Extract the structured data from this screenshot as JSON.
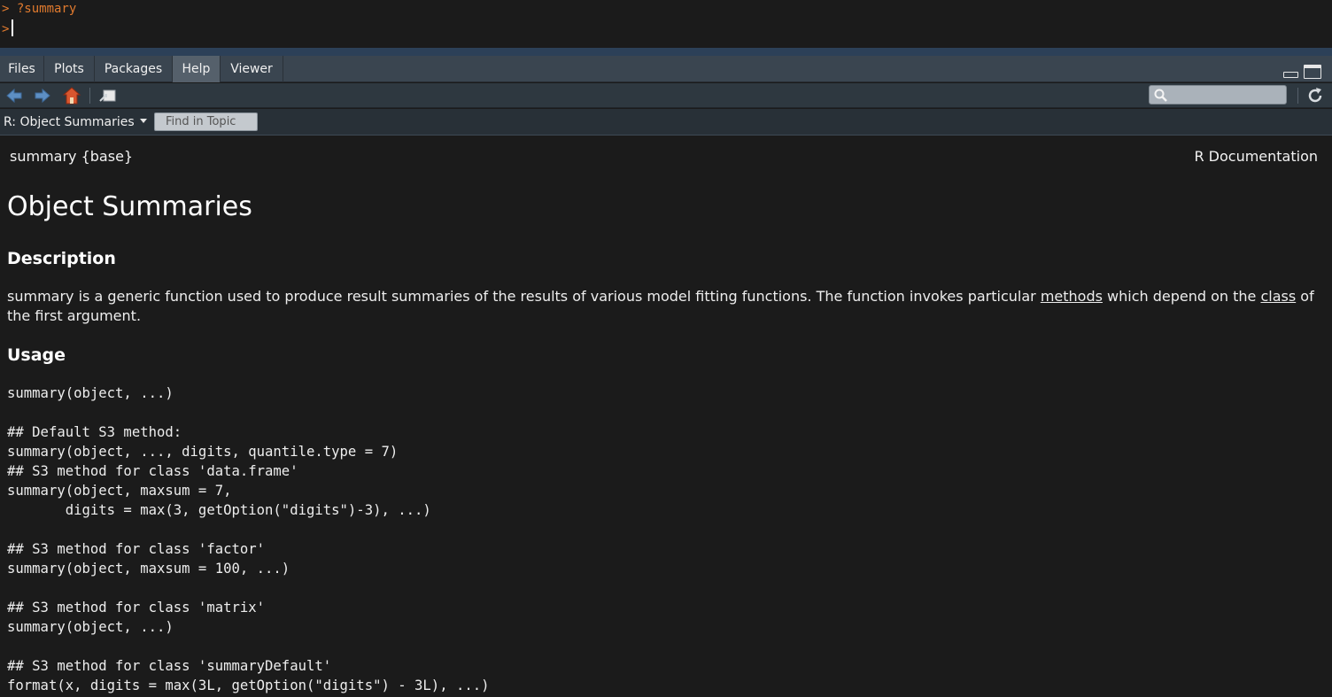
{
  "console": {
    "line1": "> ?summary",
    "prompt": ">"
  },
  "tabs": [
    {
      "label": "Files"
    },
    {
      "label": "Plots"
    },
    {
      "label": "Packages"
    },
    {
      "label": "Help",
      "active": true
    },
    {
      "label": "Viewer"
    }
  ],
  "toolbar": {
    "icons": [
      "back-arrow-icon",
      "forward-arrow-icon",
      "home-icon",
      "popout-icon",
      "search-icon",
      "refresh-icon"
    ],
    "search_placeholder": ""
  },
  "topic": {
    "selected": "R: Object Summaries",
    "find_label": "Find in Topic"
  },
  "doc": {
    "header_left": "summary {base}",
    "header_right": "R Documentation",
    "title": "Object Summaries",
    "description_heading": "Description",
    "description": {
      "fn": "summary",
      "text_a": " is a generic function used to produce result summaries of the results of various model fitting functions. The function invokes particular ",
      "link_methods": "methods",
      "text_b": " which depend on the ",
      "link_class": "class",
      "text_c": " of the first argument."
    },
    "usage_heading": "Usage",
    "usage_lines": [
      "summary(object, ...)",
      "",
      "## Default S3 method:",
      "summary(object, ..., digits, quantile.type = 7)",
      "## S3 method for class 'data.frame'",
      "summary(object, maxsum = 7,",
      "       digits = max(3, getOption(\"digits\")-3), ...)",
      "",
      "## S3 method for class 'factor'",
      "summary(object, maxsum = 100, ...)",
      "",
      "## S3 method for class 'matrix'",
      "summary(object, ...)",
      "",
      "## S3 method for class 'summaryDefault'",
      "format(x, digits = max(3L, getOption(\"digits\") - 3L), ...)"
    ]
  },
  "colors": {
    "console_text": "#e07a2e",
    "background": "#1b1b1b",
    "tabbar": "#3a4550",
    "active_tab": "#55606b"
  }
}
